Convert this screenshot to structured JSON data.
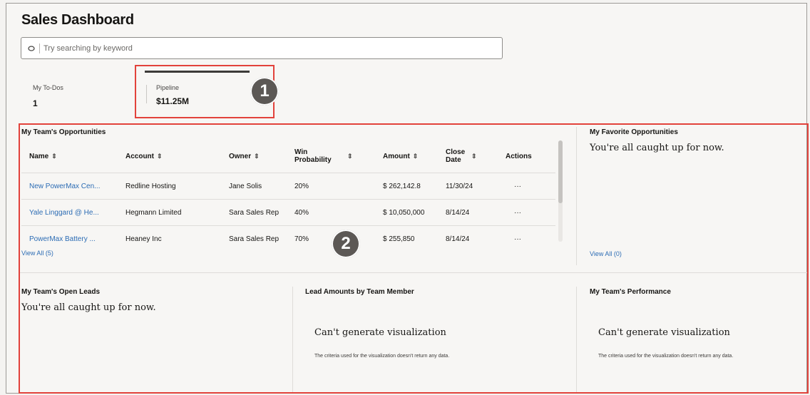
{
  "page": {
    "title": "Sales Dashboard",
    "search_placeholder": "Try searching by keyword"
  },
  "kpis": {
    "todos": {
      "label": "My To-Dos",
      "value": "1"
    },
    "pipeline": {
      "label": "Pipeline",
      "value": "$11.25M"
    }
  },
  "callouts": {
    "one": "1",
    "two": "2"
  },
  "opportunities": {
    "title": "My Team's Opportunities",
    "columns": {
      "name": "Name",
      "account": "Account",
      "owner": "Owner",
      "win": "Win Probability",
      "amount": "Amount",
      "close": "Close Date",
      "actions": "Actions"
    },
    "rows": [
      {
        "name": "New PowerMax Cen...",
        "account": "Redline Hosting",
        "owner": "Jane Solis",
        "win": "20%",
        "amount": "$ 262,142.8",
        "close": "11/30/24",
        "actions": "···"
      },
      {
        "name": "Yale Linggard @ He...",
        "account": "Hegmann Limited",
        "owner": "Sara Sales Rep",
        "win": "40%",
        "amount": "$ 10,050,000",
        "close": "8/14/24",
        "actions": "···"
      },
      {
        "name": "PowerMax Battery ...",
        "account": "Heaney Inc",
        "owner": "Sara Sales Rep",
        "win": "70%",
        "amount": "$ 255,850",
        "close": "8/14/24",
        "actions": "···"
      }
    ],
    "view_all": "View All (5)"
  },
  "favorites": {
    "title": "My Favorite Opportunities",
    "empty": "You're all caught up for now.",
    "view_all": "View All (0)"
  },
  "leads": {
    "title": "My Team's Open Leads",
    "empty": "You're all caught up for now."
  },
  "lead_amounts": {
    "title": "Lead Amounts by Team Member",
    "message": "Can't generate visualization",
    "sub": "The criteria used for the visualization doesn't return any data."
  },
  "performance": {
    "title": "My Team's Performance",
    "message": "Can't generate visualization",
    "sub": "The criteria used for the visualization doesn't return any data."
  },
  "colors": {
    "link": "#2c6cb4",
    "highlight": "#e2423b",
    "callout": "#5c5855"
  }
}
